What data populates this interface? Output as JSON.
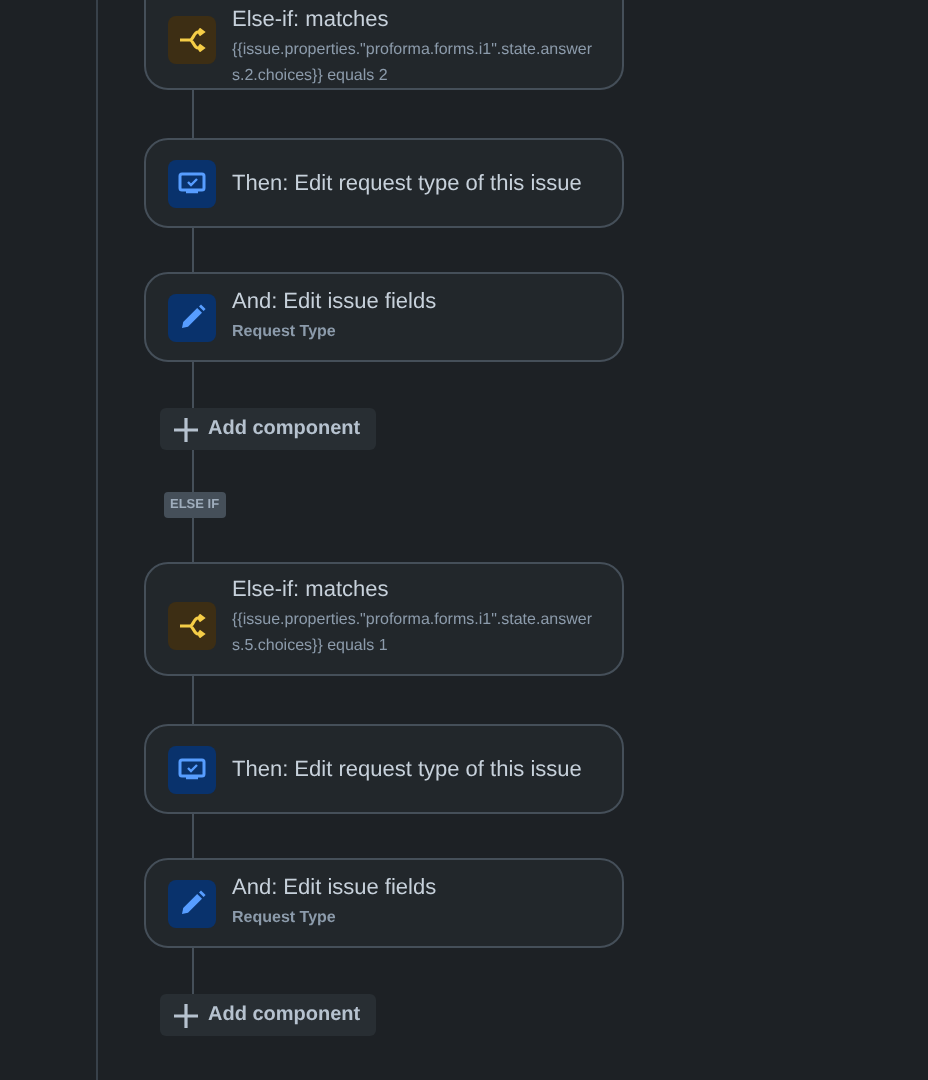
{
  "flow": [
    {
      "kind": "condition",
      "title": "Else-if: matches",
      "detail": "{{issue.properties.\"proforma.forms.i1\".state.answers.2.choices}} equals 2"
    },
    {
      "kind": "screen",
      "title": "Then: Edit request type of this issue"
    },
    {
      "kind": "edit",
      "title": "And: Edit issue fields",
      "detail": "Request Type"
    },
    {
      "kind": "add",
      "title": "Add component"
    },
    {
      "kind": "badge",
      "title": "ELSE IF"
    },
    {
      "kind": "condition",
      "title": "Else-if: matches",
      "detail": "{{issue.properties.\"proforma.forms.i1\".state.answers.5.choices}} equals 1"
    },
    {
      "kind": "screen",
      "title": "Then: Edit request type of this issue"
    },
    {
      "kind": "edit",
      "title": "And: Edit issue fields",
      "detail": "Request Type"
    },
    {
      "kind": "add",
      "title": "Add component"
    }
  ]
}
